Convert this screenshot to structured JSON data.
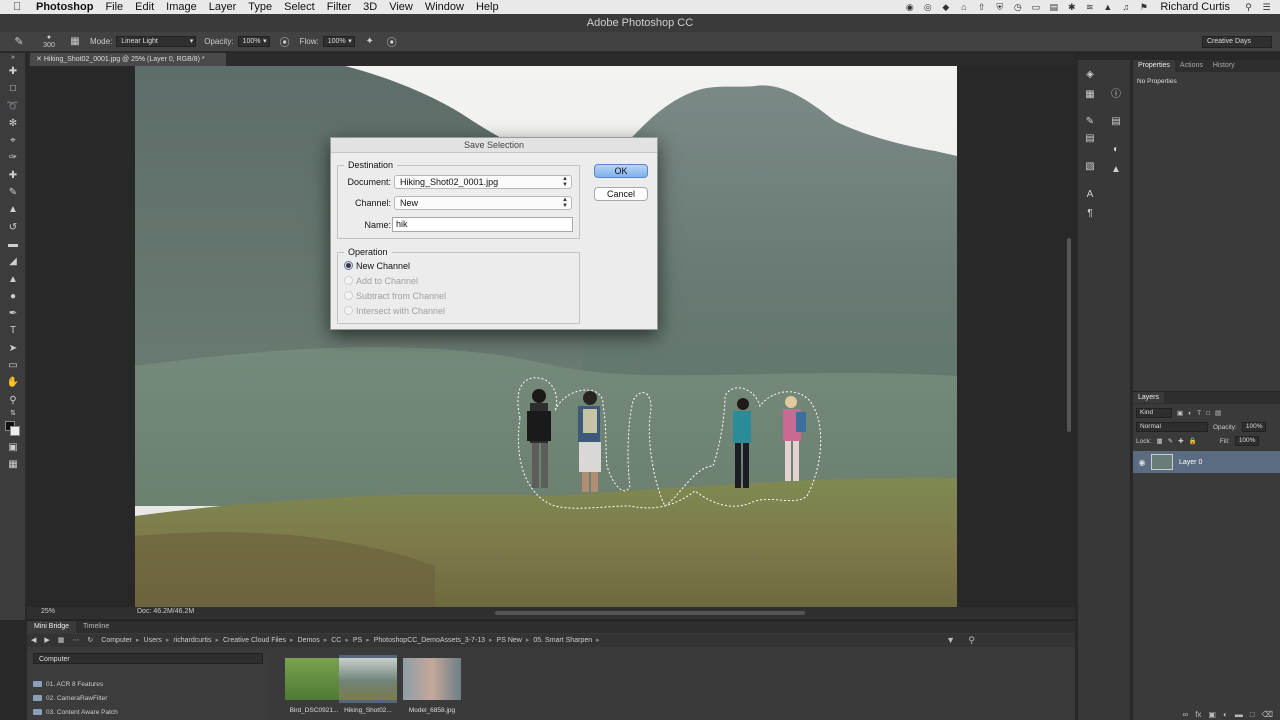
{
  "menubar": {
    "app": "Photoshop",
    "items": [
      "File",
      "Edit",
      "Image",
      "Layer",
      "Type",
      "Select",
      "Filter",
      "3D",
      "View",
      "Window",
      "Help"
    ],
    "user": "Richard Curtis"
  },
  "window_title": "Adobe Photoshop CC",
  "options": {
    "brush_size": "300",
    "mode_label": "Mode:",
    "mode_value": "Linear Light",
    "opacity_label": "Opacity:",
    "opacity_value": "100%",
    "flow_label": "Flow:",
    "flow_value": "100%",
    "workspace": "Creative Days"
  },
  "document_tab": "Hiking_Shot02_0001.jpg @ 25% (Layer 0, RGB/8) *",
  "status": {
    "zoom": "25%",
    "doc_info": "Doc: 46.2M/46.2M"
  },
  "bridge": {
    "tabs": [
      "Mini Bridge",
      "Timeline"
    ],
    "path": [
      "Computer",
      "Users",
      "richardcurtis",
      "Creative Cloud Files",
      "Demos",
      "CC",
      "PS",
      "PhotoshopCC_DemoAssets_3-7-13",
      "PS New",
      "05. Smart Sharpen"
    ],
    "location": "Computer",
    "folders": [
      "01. ACR 8 Features",
      "02. CameraRawFilter",
      "03. Content Aware Patch"
    ],
    "thumbnails": [
      {
        "caption": "Bird_DSC0921..."
      },
      {
        "caption": "Hiking_Shot02..."
      },
      {
        "caption": "Model_6858.jpg"
      }
    ]
  },
  "properties_panel": {
    "tabs": [
      "Properties",
      "Actions",
      "History"
    ],
    "empty_text": "No Properties"
  },
  "layers_panel": {
    "tab": "Layers",
    "kind": "Kind",
    "blend_mode": "Normal",
    "opacity_label": "Opacity:",
    "opacity_value": "100%",
    "lock_label": "Lock:",
    "fill_label": "Fill:",
    "fill_value": "100%",
    "layer_name": "Layer 0"
  },
  "dialog": {
    "title": "Save Selection",
    "destination_legend": "Destination",
    "document_label": "Document:",
    "document_value": "Hiking_Shot02_0001.jpg",
    "channel_label": "Channel:",
    "channel_value": "New",
    "name_label": "Name:",
    "name_value": "hik",
    "operation_legend": "Operation",
    "operations": [
      "New Channel",
      "Add to Channel",
      "Subtract from Channel",
      "Intersect with Channel"
    ],
    "selected_operation": "New Channel",
    "ok_label": "OK",
    "cancel_label": "Cancel"
  }
}
